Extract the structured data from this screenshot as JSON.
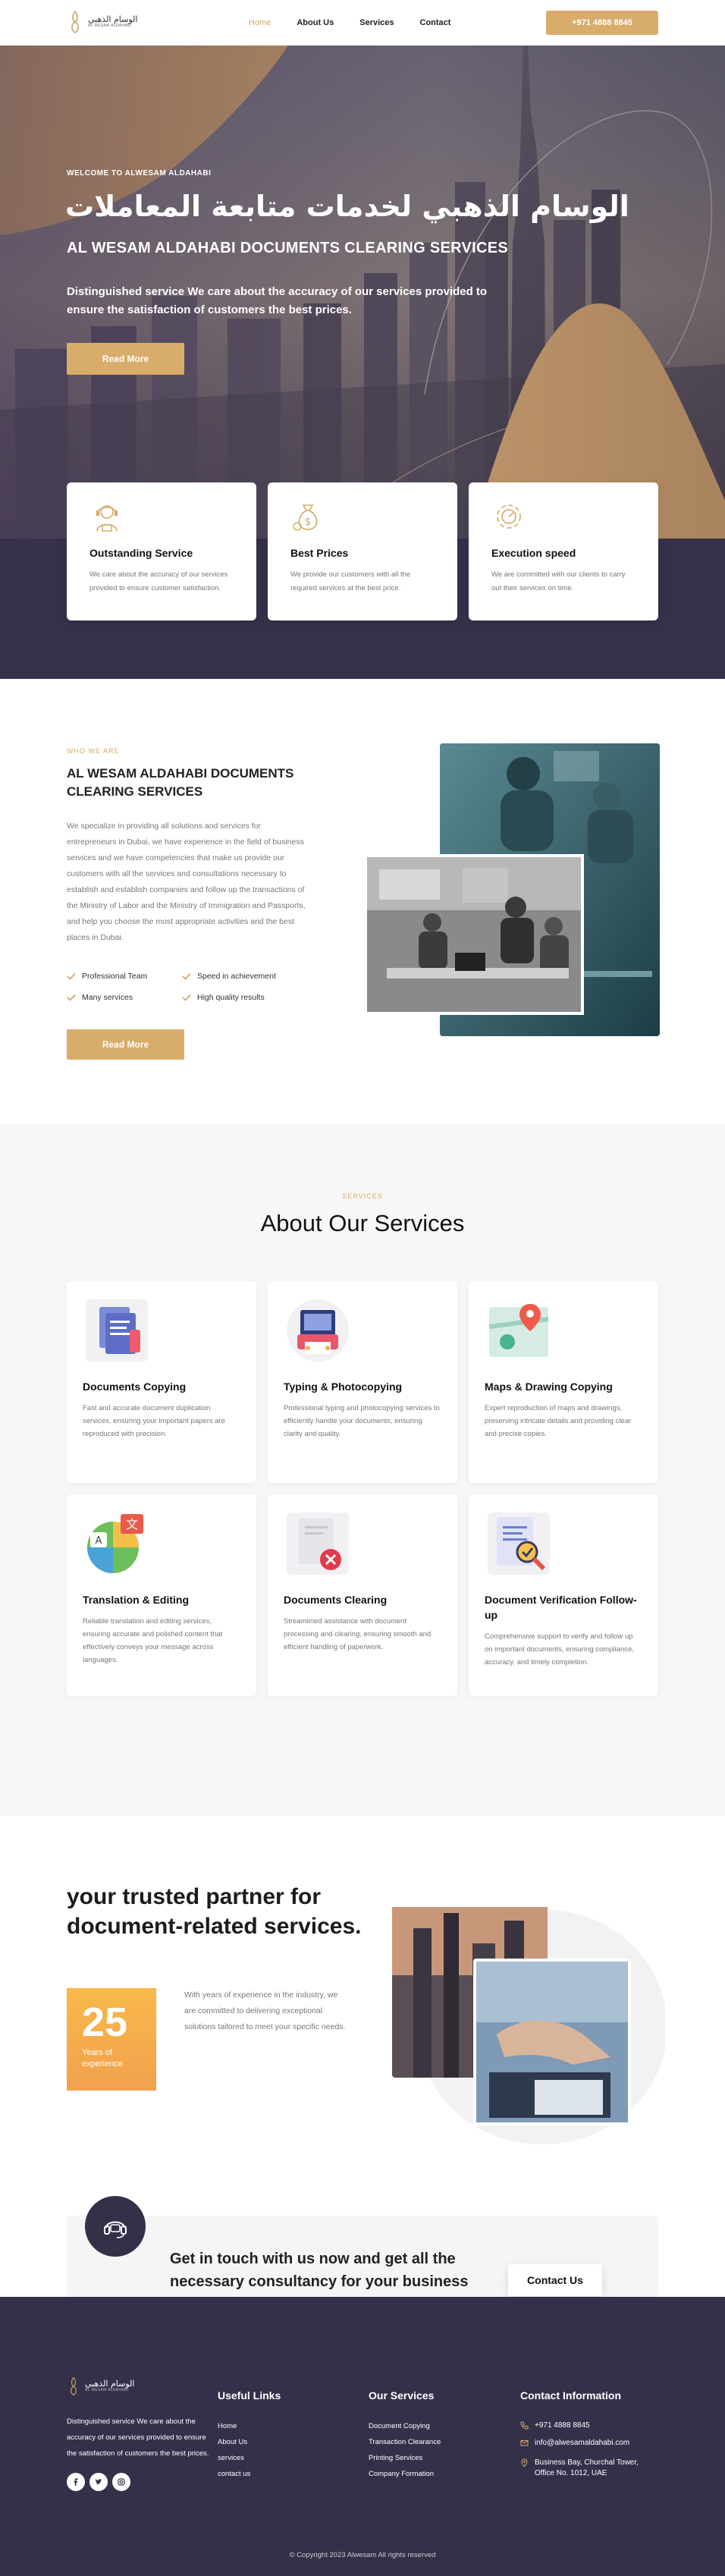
{
  "header": {
    "logo_ar": "الوسام الذهبي",
    "logo_en": "AL WESAM ALDAHABI",
    "nav": [
      "Home",
      "About Us",
      "Services",
      "Contact"
    ],
    "phone_button": "+971 4888 8845"
  },
  "hero": {
    "welcome": "WELCOME TO ALWESAM ALDAHABI",
    "title_ar": "الوسام الذهبي لخدمات متابعة المعاملات",
    "title_en": "AL WESAM ALDAHABI DOCUMENTS CLEARING SERVICES",
    "description": "Distinguished service We care about the accuracy of our services provided to ensure the satisfaction of customers the best prices.",
    "button": "Read More"
  },
  "features": [
    {
      "icon": "support-agent-icon",
      "title": "Outstanding Service",
      "text": "We care about the accuracy of our services provided to ensure customer satisfaction."
    },
    {
      "icon": "money-bag-icon",
      "title": "Best Prices",
      "text": "We provide our customers with all the required services at the best price."
    },
    {
      "icon": "speed-gear-icon",
      "title": "Execution speed",
      "text": "We are committed with our clients to carry out their services on time."
    }
  ],
  "about": {
    "tag": "WHO WE ARE",
    "title": "AL WESAM ALDAHABI DOCUMENTS CLEARING SERVICES",
    "text": "We specialize in providing all solutions and services for entrepreneurs in Dubai, we have experience in the field of business services and we have competencies that make us provide our customers with all the services and consultations necessary to establish and establish companies and follow up the transactions of the Ministry of Labor and the Ministry of Immigration and Passports, and help you choose the most appropriate activities and the best places in Dubai.",
    "checks": [
      "Professional Team",
      "Speed in achievement",
      "Many services",
      "High quality results"
    ],
    "button": "Read More"
  },
  "services": {
    "tag": "SERVICES",
    "title": "About Our Services",
    "items": [
      {
        "icon": "document-copy-icon",
        "title": "Documents Copying",
        "text": "Fast and accurate document duplication services, ensuring your important papers are reproduced with precision."
      },
      {
        "icon": "printer-icon",
        "title": "Typing & Photocopying",
        "text": "Professional typing and photocopying services to efficiently handle your documents, ensuring clarity and quality."
      },
      {
        "icon": "map-pin-icon",
        "title": "Maps & Drawing Copying",
        "text": "Expert reproduction of maps and drawings, preserving intricate details and providing clear and precise copies."
      },
      {
        "icon": "translation-icon",
        "title": "Translation & Editing",
        "text": "Reliable translation and editing services, ensuring accurate and polished content that effectively conveys your message across languages."
      },
      {
        "icon": "document-clear-icon",
        "title": "Documents Clearing",
        "text": "Streamlined assistance with document processing and clearing, ensuring smooth and efficient handling of paperwork."
      },
      {
        "icon": "document-verify-icon",
        "title": "Document Verification Follow-up",
        "text": "Comprehensive support to verify and follow up on important documents, ensuring compliance, accuracy, and timely completion."
      }
    ]
  },
  "partner": {
    "title": "your trusted partner for document-related services.",
    "years": "25",
    "years_label": "Years of experience",
    "text": "With years of experience in the industry, we are committed to delivering exceptional solutions tailored to meet your specific needs."
  },
  "cta": {
    "text": "Get in touch with us now and get all the necessary consultancy for your business and the UAE!",
    "button": "Contact Us"
  },
  "footer": {
    "description": "Distinguished service We care about the accuracy of our services provided to ensure the satisfaction of customers the best prices.",
    "useful_links_title": "Useful Links",
    "useful_links": [
      "Home",
      "About Us",
      "services",
      "contact us"
    ],
    "services_title": "Our Services",
    "services": [
      "Document Copying",
      "Transaction Clearance",
      "Printing Services",
      "Company Formation"
    ],
    "contact_title": "Contact Information",
    "phone": "+971 4888 8845",
    "email": "info@alwesamaldahabi.com",
    "address": "Business Bay, Churchal Tower, Office No. 1012, UAE",
    "copyright": "© Copyright 2023 Alwesam All rights reserved"
  },
  "colors": {
    "accent": "#d8ad6c",
    "dark": "#35304a",
    "orange": "#f4a84c"
  }
}
